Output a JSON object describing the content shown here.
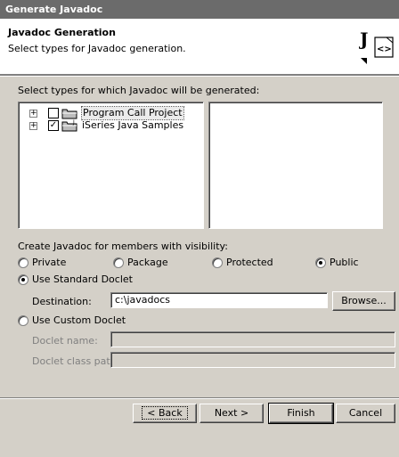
{
  "window": {
    "title": "Generate Javadoc"
  },
  "banner": {
    "title": "Javadoc Generation",
    "description": "Select types for Javadoc generation.",
    "icon": "javadoc-wizard-icon"
  },
  "types_label": "Select types for which Javadoc will be generated:",
  "tree": [
    {
      "label": "Program Call Project",
      "checked": false,
      "selected": true
    },
    {
      "label": "iSeries Java Samples",
      "checked": true,
      "selected": false
    }
  ],
  "visibility": {
    "label": "Create Javadoc for members with visibility:",
    "options": [
      "Private",
      "Package",
      "Protected",
      "Public"
    ],
    "selected": "Public"
  },
  "standard_doclet": {
    "label": "Use Standard Doclet",
    "selected": true,
    "destination_label": "Destination:",
    "destination_value": "c:\\javadocs",
    "browse_label": "Browse..."
  },
  "custom_doclet": {
    "label": "Use Custom Doclet",
    "selected": false,
    "name_label": "Doclet name:",
    "name_value": "",
    "classpath_label": "Doclet class path:",
    "classpath_value": ""
  },
  "buttons": {
    "back": "< Back",
    "next": "Next >",
    "finish": "Finish",
    "cancel": "Cancel"
  }
}
